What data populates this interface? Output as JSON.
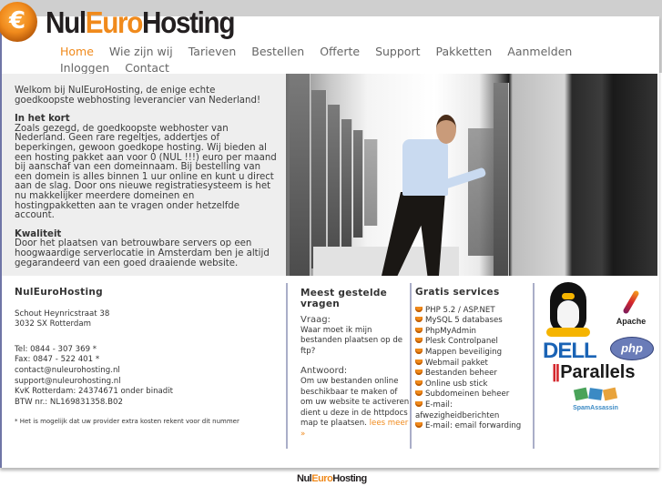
{
  "brand": {
    "logo_part1": "Nul",
    "logo_part2": "Euro",
    "logo_part3": "Hosting",
    "badge_glyph": "€",
    "accent_color": "#f08a1c"
  },
  "nav": {
    "items": [
      {
        "label": "Home",
        "active": true
      },
      {
        "label": "Wie zijn wij"
      },
      {
        "label": "Tarieven"
      },
      {
        "label": "Bestellen"
      },
      {
        "label": "Offerte"
      },
      {
        "label": "Support"
      },
      {
        "label": "Pakketten"
      },
      {
        "label": "Aanmelden"
      },
      {
        "label": "Inloggen"
      },
      {
        "label": "Contact"
      }
    ]
  },
  "hero": {
    "welcome": "Welkom bij NulEuroHosting, de enige echte goedkoopste webhosting leverancier van Nederland!",
    "section1_title": "In het kort",
    "section1_text": "Zoals gezegd, de goedkoopste webhoster van Nederland. Geen rare regeltjes, addertjes of beperkingen, gewoon goedkope hosting. Wij bieden al een hosting pakket aan voor 0 (NUL !!!) euro per maand bij aanschaf van een domeinnaam. Bij bestelling van een domein is alles binnen 1 uur online en kunt u direct aan de slag. Door ons nieuwe registratiesysteem is het nu makkelijker meerdere domeinen en hostingpakketten aan te vragen onder hetzelfde account.",
    "section2_title": "Kwaliteit",
    "section2_text": "Door het plaatsen van betrouwbare servers op een hoogwaardige serverlocatie in Amsterdam ben je altijd gegarandeerd van een goed draaiende website."
  },
  "contact": {
    "title": "NulEuroHosting",
    "address_line1": "Schout Heynricstraat 38",
    "address_line2": "3032 SX Rotterdam",
    "tel": "Tel: 0844 - 307 369 *",
    "fax": "Fax: 0847 - 522 401 *",
    "email1": "contact@nuleurohosting.nl",
    "email2": "support@nuleurohosting.nl",
    "kvk": "KvK Rotterdam: 24374671 onder binadit",
    "btw": "BTW nr.: NL169831358.B02",
    "note": "* Het is mogelijk dat uw provider extra kosten rekent voor dit nummer"
  },
  "faq": {
    "title": "Meest gestelde vragen",
    "question_label": "Vraag:",
    "question": "Waar moet ik mijn bestanden plaatsen op de ftp?",
    "answer_label": "Antwoord:",
    "answer": "Om uw bestanden online beschikbaar te maken of om uw website te activeren dient u deze in de httpdocs map te plaatsen.",
    "read_more": "lees meer »"
  },
  "services": {
    "title": "Gratis services",
    "items": [
      "PHP 5.2 / ASP.NET",
      "MySQL 5 databases",
      "PhpMyAdmin",
      "Plesk Controlpanel",
      "Mappen beveiliging",
      "Webmail pakket",
      "Bestanden beheer",
      "Online usb stick",
      "Subdomeinen beheer",
      "E-mail: afwezigheidberichten",
      "E-mail: email forwarding"
    ]
  },
  "partner_logos": {
    "linux": "Linux Tux",
    "apache": "Apache",
    "dell": "DELL",
    "php": "php",
    "parallels_bars": "||",
    "parallels": "Parallels",
    "spamassassin": "SpamAssassin"
  }
}
